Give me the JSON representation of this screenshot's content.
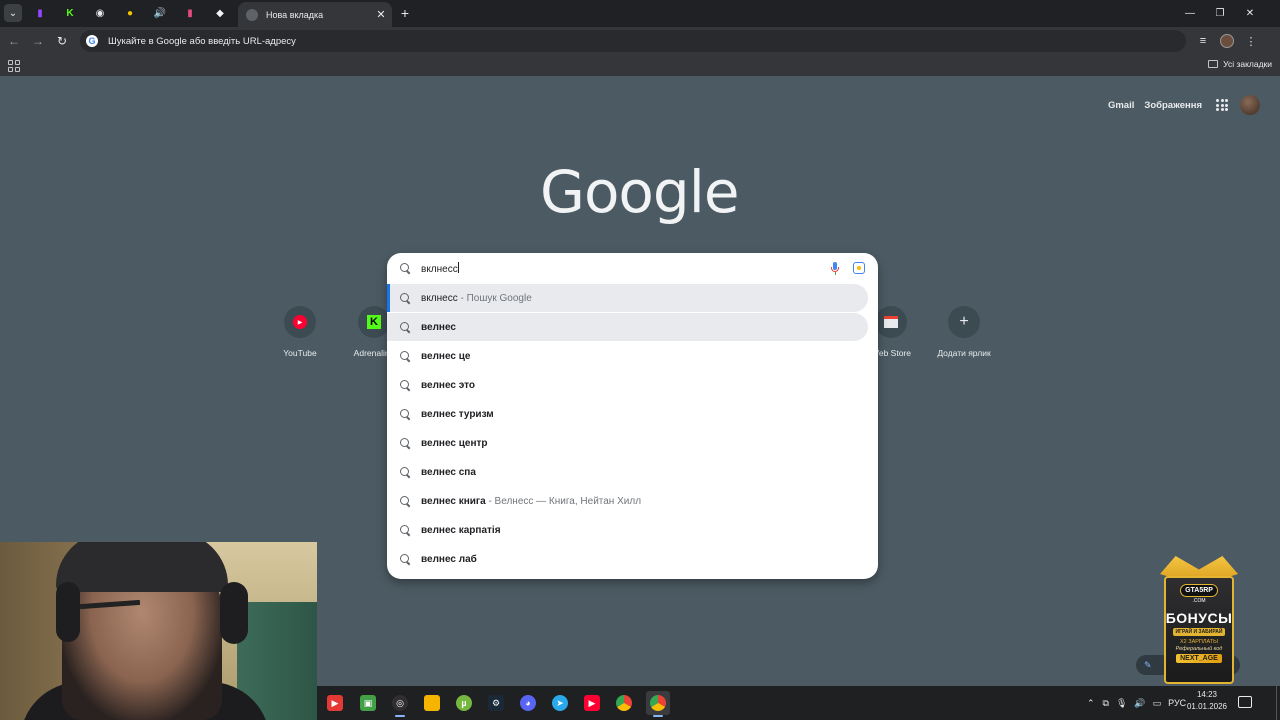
{
  "browser": {
    "tabs": [
      {
        "icon": "twitch-icon",
        "color": "#9146ff",
        "glyph": "▮"
      },
      {
        "icon": "kick-icon",
        "color": "#53fc18",
        "glyph": "K"
      },
      {
        "icon": "spy-icon",
        "color": "#e8eaed",
        "glyph": "◉"
      },
      {
        "icon": "yellow-cloud-icon",
        "color": "#f5c400",
        "glyph": "●"
      },
      {
        "icon": "speaker-icon",
        "color": "#e8eaed",
        "glyph": "🔊"
      },
      {
        "icon": "pink-doc-icon",
        "color": "#e84a7f",
        "glyph": "▮"
      },
      {
        "icon": "rose-app-icon",
        "color": "#f2f2f2",
        "glyph": "◆"
      }
    ],
    "active_tab_title": "Нова вкладка",
    "omnibox_placeholder": "Шукайте в Google або введіть URL-адресу",
    "all_bookmarks": "Усі закладки"
  },
  "page": {
    "gmail": "Gmail",
    "images": "Зображення",
    "logo": "Google",
    "shortcuts": [
      {
        "label": "YouTube",
        "icon": "youtube-icon"
      },
      {
        "label": "Adrenalin_",
        "icon": "kick-icon"
      },
      {
        "label": "Web Store",
        "icon": "web-store-icon"
      },
      {
        "label": "Додати ярлик",
        "icon": "plus-icon"
      }
    ]
  },
  "search": {
    "query": "вклнесс",
    "suggestions": [
      {
        "bold": "вклнесс",
        "desc": " - Пошук Google"
      },
      {
        "bold": "велнес",
        "desc": ""
      },
      {
        "bold": "велнес це",
        "desc": ""
      },
      {
        "bold": "велнес это",
        "desc": ""
      },
      {
        "bold": "велнес туризм",
        "desc": ""
      },
      {
        "bold": "велнес центр",
        "desc": ""
      },
      {
        "bold": "велнес спа",
        "desc": ""
      },
      {
        "bold": "велнес книга",
        "desc": " - Велнесс — Книга, Нейтан Хилл"
      },
      {
        "bold": "велнес карпатія",
        "desc": ""
      },
      {
        "bold": "велнес лаб",
        "desc": ""
      }
    ]
  },
  "bonus_ad": {
    "logo": "GTA5RP",
    "logo_sub": ".COM",
    "title": "БОНУСЫ",
    "tagline": "ИГРАЙ И ЗАБИРАЙ",
    "line": "Х2 ЗАРПЛАТЫ",
    "signature": "Реферальный код",
    "code": "NEXT_AGE"
  },
  "taskbar": {
    "language": "РУС",
    "time": "14:23",
    "date": "01.01.2026"
  }
}
